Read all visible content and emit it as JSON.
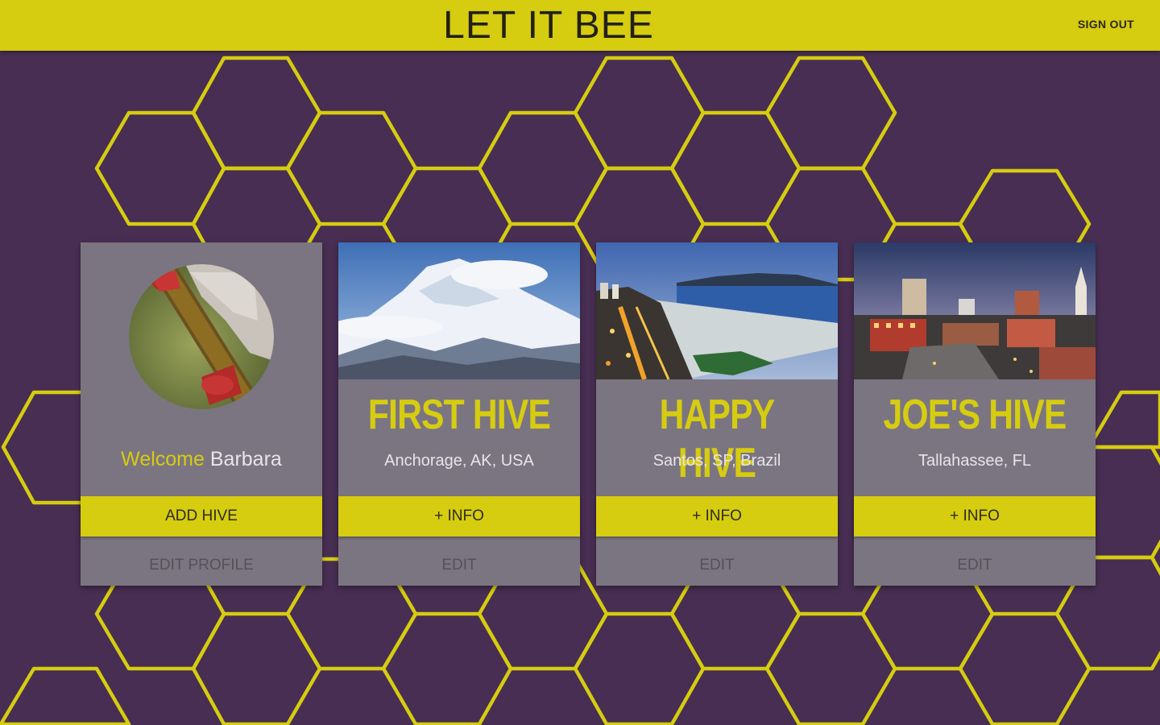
{
  "header": {
    "title": "LET IT BEE",
    "sign_out_label": "SIGN OUT"
  },
  "colors": {
    "background": "#472e52",
    "accent": "#d6cc10",
    "card": "#7b7581"
  },
  "profile_card": {
    "welcome_word": "Welcome",
    "user_name": "Barbara",
    "avatar_icon": "beekeeper-photo",
    "add_hive_label": "ADD HIVE",
    "edit_profile_label": "EDIT PROFILE"
  },
  "hives": [
    {
      "name": "FIRST HIVE",
      "location": "Anchorage, AK, USA",
      "image": "snowy-mountain-photo",
      "info_label": "+ INFO",
      "edit_label": "EDIT"
    },
    {
      "name": "HAPPY HIVE",
      "location": "Santos, SP, Brazil",
      "image": "beach-city-night-photo",
      "info_label": "+ INFO",
      "edit_label": "EDIT"
    },
    {
      "name": "JOE'S HIVE",
      "location": "Tallahassee, FL",
      "image": "city-skyline-dusk-photo",
      "info_label": "+ INFO",
      "edit_label": "EDIT"
    }
  ]
}
